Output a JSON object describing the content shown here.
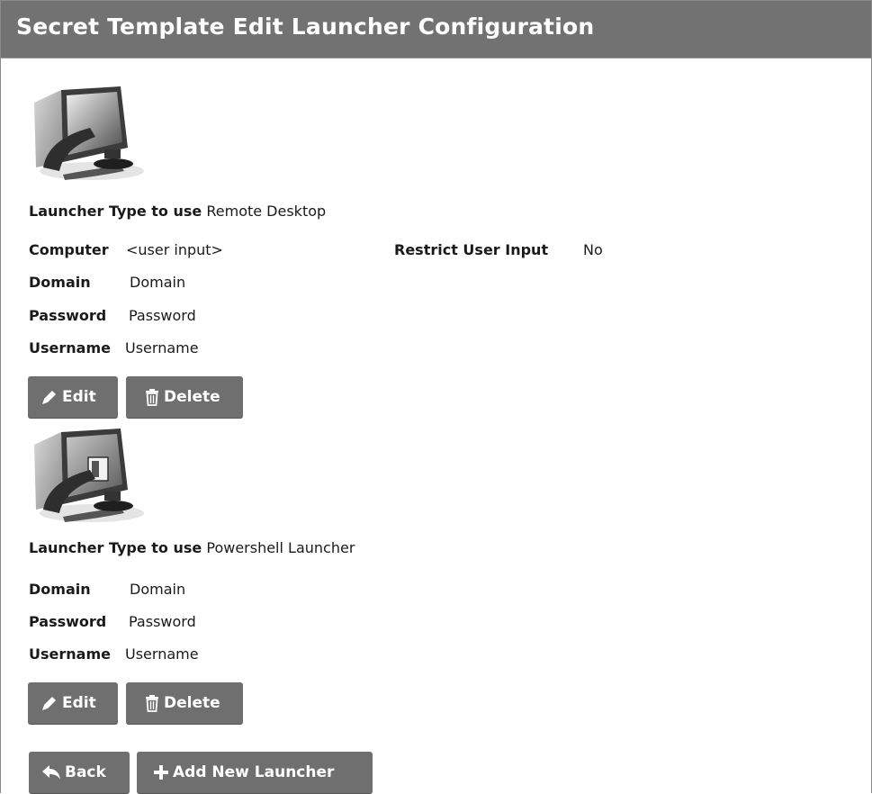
{
  "page": {
    "title": "Secret Template Edit Launcher Configuration"
  },
  "launchers": [
    {
      "type_label": "Launcher Type to use",
      "type_value": "Remote Desktop",
      "fields": [
        {
          "label": "Computer",
          "value": "<user input>"
        },
        {
          "label": "Domain",
          "value": "Domain"
        },
        {
          "label": "Password",
          "value": "Password"
        },
        {
          "label": "Username",
          "value": "Username"
        }
      ],
      "extra": {
        "label": "Restrict User Input",
        "value": "No"
      },
      "edit_label": "Edit",
      "delete_label": "Delete",
      "icon": "remote-desktop-monitor-icon"
    },
    {
      "type_label": "Launcher Type to use",
      "type_value": "Powershell Launcher",
      "fields": [
        {
          "label": "Domain",
          "value": "Domain"
        },
        {
          "label": "Password",
          "value": "Password"
        },
        {
          "label": "Username",
          "value": "Username"
        }
      ],
      "edit_label": "Edit",
      "delete_label": "Delete",
      "icon": "powershell-monitor-icon"
    }
  ],
  "actions": {
    "back_label": "Back",
    "add_label": "Add New Launcher"
  },
  "colors": {
    "header_bg": "#727272",
    "button_bg": "#6f6f6f",
    "text": "#1a1a1a"
  }
}
